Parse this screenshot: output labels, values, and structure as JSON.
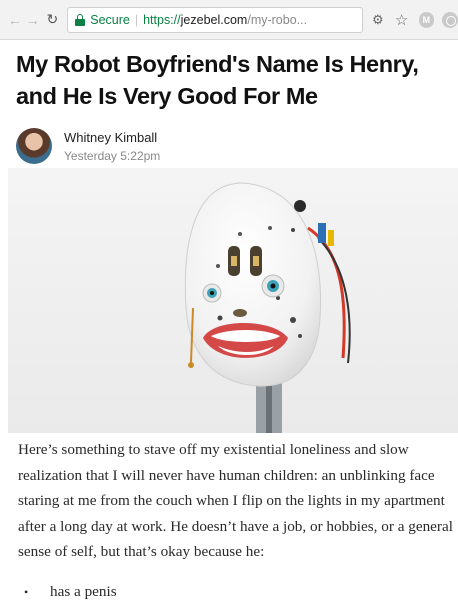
{
  "browser": {
    "secure_label": "Secure",
    "url_scheme": "https://",
    "url_host": "jezebel.com",
    "url_path": "/my-robo...",
    "icons": [
      "back-arrow-icon",
      "forward-arrow-icon",
      "reload-icon",
      "lock-icon",
      "extension-icon",
      "star-icon",
      "extension-icon",
      "extension-icon"
    ]
  },
  "article": {
    "title": "My Robot Boyfriend's Name Is Henry, and He Is Very Good For Me",
    "author": "Whitney Kimball",
    "timestamp": "Yesterday 5:22pm",
    "paragraph": "Here’s something to stave off my existential loneliness and slow realization that I will never have human children: an unblinking face staring at me from the couch when I flip on the lights in my apartment after a long day at work. He doesn’t have a job, or hobbies, or a general sense of self, but that’s okay because he:",
    "list_items": [
      "has a penis"
    ]
  },
  "colors": {
    "secure_green": "#0b8043",
    "title": "#111111",
    "meta_gray": "#888888"
  }
}
